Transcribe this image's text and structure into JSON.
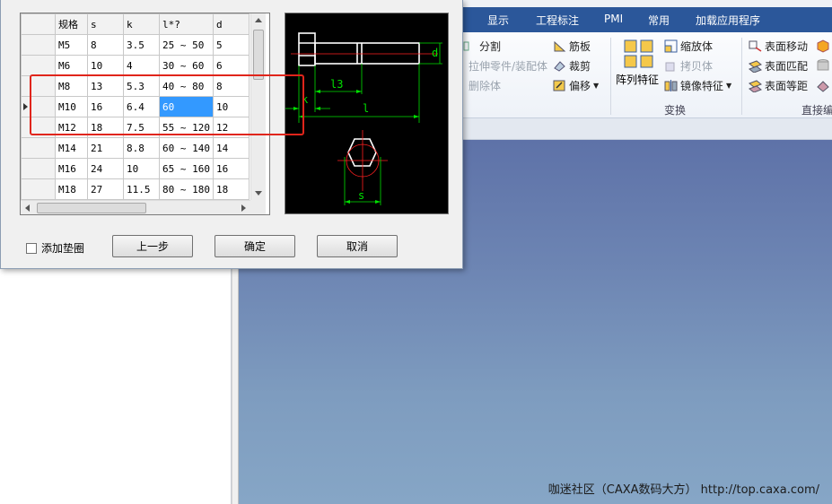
{
  "ribbon": {
    "tabs": [
      "显示",
      "工程标注",
      "PMI",
      "常用",
      "加载应用程序"
    ],
    "items": {
      "split": "分割",
      "stretch_part": "拉伸零件/装配体",
      "delete_body": "删除体",
      "rib": "筋板",
      "trim": "裁剪",
      "offset": "偏移",
      "pattern_feature": "阵列特征",
      "scale_body": "缩放体",
      "copy_body": "拷贝体",
      "mirror_feature": "镜像特征",
      "surface_move": "表面移动",
      "surface_match": "表面匹配",
      "surface_equidistant": "表面等距"
    },
    "groups": {
      "transform": "变换",
      "direct_edit": "直接编"
    }
  },
  "watermark": "咖迷社区（CAXA数码大方） http://top.caxa.com/",
  "table": {
    "headers": [
      "规格",
      "s",
      "k",
      "l*?",
      "d"
    ],
    "rows": [
      [
        "M5",
        "8",
        "3.5",
        "25 ~ 50",
        "5"
      ],
      [
        "M6",
        "10",
        "4",
        "30 ~ 60",
        "6"
      ],
      [
        "M8",
        "13",
        "5.3",
        "40 ~ 80",
        "8"
      ],
      [
        "M10",
        "16",
        "6.4",
        "60",
        "10"
      ],
      [
        "M12",
        "18",
        "7.5",
        "55 ~ 120",
        "12"
      ],
      [
        "M14",
        "21",
        "8.8",
        "60 ~ 140",
        "14"
      ],
      [
        "M16",
        "24",
        "10",
        "65 ~ 160",
        "16"
      ],
      [
        "M18",
        "27",
        "11.5",
        "80 ~ 180",
        "18"
      ]
    ],
    "current_row": 3,
    "selected_cell": [
      3,
      3
    ]
  },
  "preview": {
    "labels": {
      "k": "k",
      "l13": "l3",
      "l": "l",
      "d": "d",
      "s": "s"
    },
    "colors": {
      "outline": "#ffffff",
      "centerline": "#ff2020",
      "dimension": "#00e000"
    }
  },
  "dialog": {
    "add_washer": "添加垫圈",
    "add_washer_checked": false,
    "prev_button": "上一步",
    "ok_button": "确定",
    "cancel_button": "取消"
  },
  "colors": {
    "ribbon_tab_bg": "#2b579a",
    "selection": "#3399ff",
    "highlight_box": "#e0251b"
  }
}
